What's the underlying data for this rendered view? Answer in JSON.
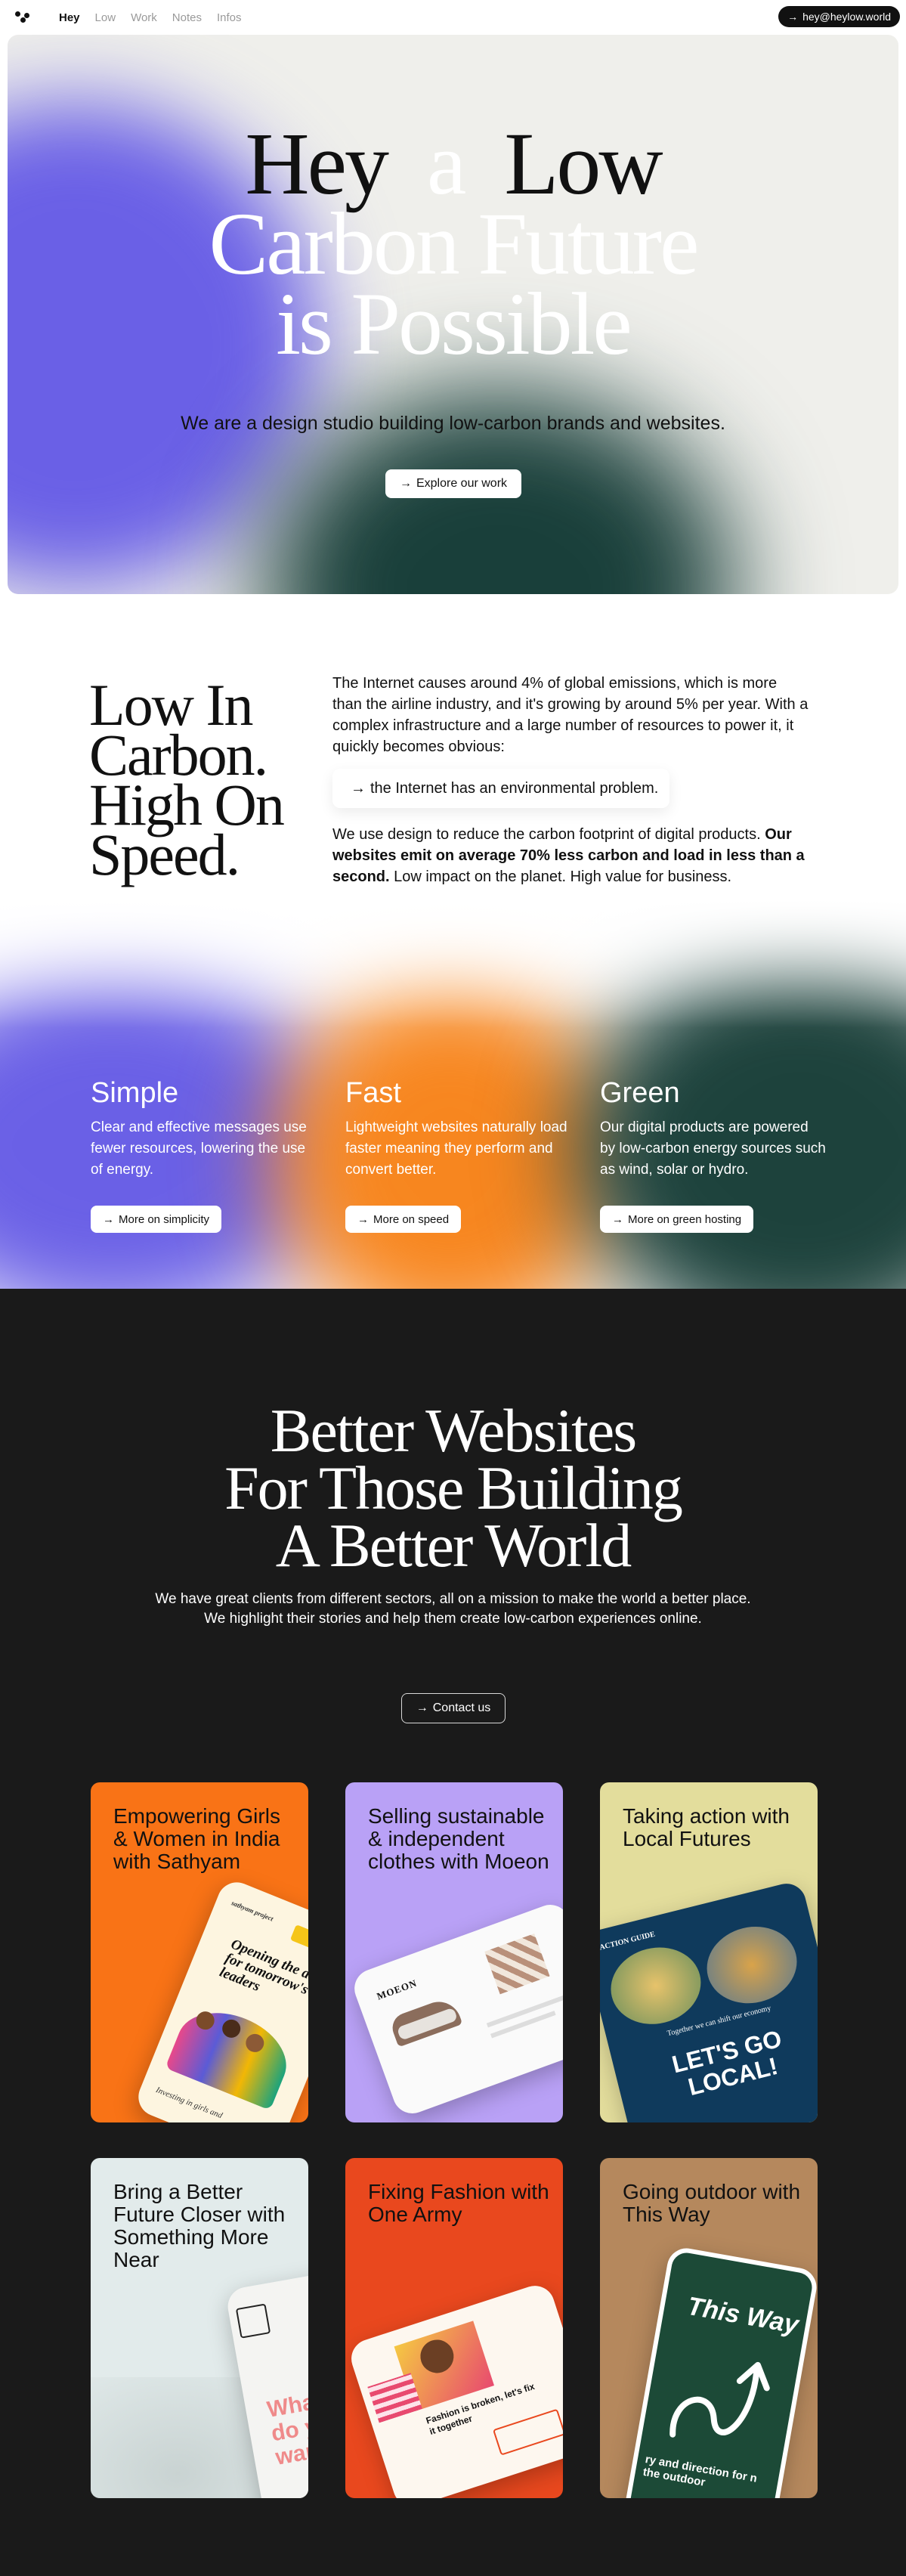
{
  "nav": {
    "links": [
      "Hey",
      "Low",
      "Work",
      "Notes",
      "Infos"
    ],
    "email": "hey@heylow.world",
    "arrow": "→"
  },
  "hero": {
    "title_line1_a": "Hey",
    "title_line1_b": "a",
    "title_line1_c": "Low",
    "title_line2": "Carbon Future",
    "title_line3": "is Possible",
    "subtitle": "We are a design studio building low-carbon brands and websites.",
    "cta": "Explore our work"
  },
  "intro": {
    "title": "Low In Carbon. High On Speed.",
    "p1": "The Internet causes around 4% of global emissions, which is more than the airline industry, and it's growing by around 5% per year. With a complex infrastructure and a large number of resources to power it, it quickly becomes obvious:",
    "quote": "the Internet has an environmental problem.",
    "p2_a": "We use design to reduce the carbon footprint of digital products.",
    "p2_b": "Our websites emit on average 70% less carbon and load in less than a second.",
    "p2_c": "Low impact on the planet. High value for business."
  },
  "features": [
    {
      "title": "Simple",
      "text": "Clear and effective messages use fewer resources, lowering the use of energy.",
      "button": "More on simplicity"
    },
    {
      "title": "Fast",
      "text": "Lightweight websites naturally load faster meaning they perform and convert better.",
      "button": "More on speed"
    },
    {
      "title": "Green",
      "text": "Our digital products are powered by low-carbon energy sources such as wind, solar or hydro.",
      "button": "More on green hosting"
    }
  ],
  "clients": {
    "title_line1": "Better Websites",
    "title_line2": "For Those Building",
    "title_line3": "A Better World",
    "sub1": "We have great clients from different sectors, all on a mission to make the world a better place.",
    "sub2": "We highlight their stories and help them create low-carbon experiences online.",
    "cta": "Contact us"
  },
  "cards": [
    {
      "title": "Empowering Girls & Women in India with Sathyam",
      "color": "#f97316",
      "phone_text": "Opening the doors for tomorrow's leaders",
      "phone_brand": "sathyam project",
      "phone_foot": "Investing in girls and"
    },
    {
      "title": "Selling sustainable & independent clothes with Moeon",
      "color": "#b9a1f6",
      "phone_text": "MOEON"
    },
    {
      "title": "Taking action with Local Futures",
      "color": "#e3dd9c",
      "phone_text": "LET'S GO LOCAL!",
      "phone_brand": "ACTION GUIDE",
      "phone_small": "Together we can shift our economy"
    },
    {
      "title": "Bring a Better Future Closer with Something More Near",
      "color": "#e2ebeb",
      "phone_text": "Wha do y wan"
    },
    {
      "title": "Fixing Fashion with One Army",
      "color": "#e9481e",
      "phone_text": "Fashion is broken, let's fix it together"
    },
    {
      "title": "Going outdoor with This Way",
      "color": "#b5885d",
      "phone_text": "This Way",
      "phone_foot": "ry and direction for n the outdoor"
    }
  ]
}
